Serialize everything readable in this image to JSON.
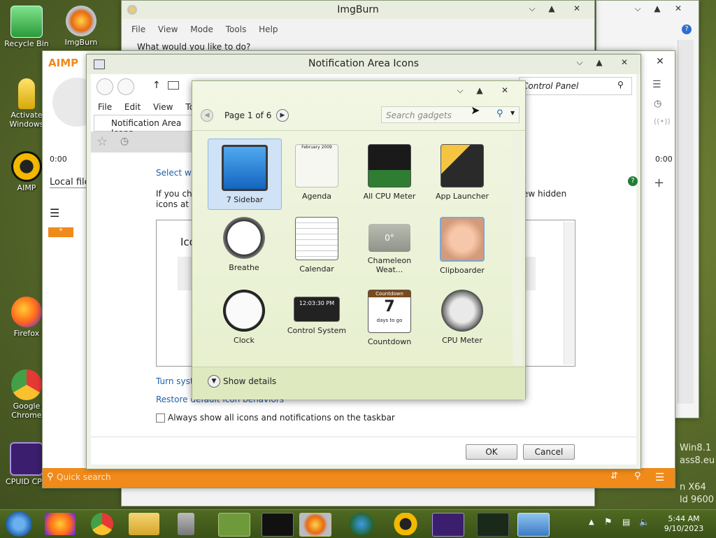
{
  "desktop": {
    "icons": [
      {
        "label": "Recycle Bin"
      },
      {
        "label": "ImgBurn"
      },
      {
        "label": "Activate Windows"
      },
      {
        "label": "AIMP"
      },
      {
        "label": "Firefox"
      },
      {
        "label": "Google Chrome"
      },
      {
        "label": "CPUID CPU"
      }
    ],
    "watermark": {
      "line1": "Win8.1",
      "line2": "ass8.eu",
      "line3": "n X64",
      "line4": "ld 9600"
    }
  },
  "imgburn": {
    "title": "ImgBurn",
    "menu": [
      "File",
      "View",
      "Mode",
      "Tools",
      "Help"
    ],
    "prompt": "What would you like to do?"
  },
  "aimp": {
    "logo": "AIMP",
    "time_left": "0:00",
    "time_right": "0:00",
    "local_files": "Local files",
    "quick_search": "Quick search",
    "tab_star": "*"
  },
  "notif": {
    "title": "Notification Area Icons",
    "address": "Control Panel",
    "menu": [
      "File",
      "Edit",
      "View",
      "Tools"
    ],
    "tab": "Notification Area Icons",
    "select_text": "Select whi",
    "if_text": "If you cho",
    "icons_text": "icons at a",
    "hidden_text": "ew hidden",
    "icon_col": "Ico",
    "turn_link": "Turn syste",
    "restore_link": "Restore default icon behaviors",
    "always_show": "Always show all icons and notifications on the taskbar",
    "ok": "OK",
    "cancel": "Cancel"
  },
  "gadgets": {
    "page": "Page 1 of 6",
    "search_placeholder": "Search gadgets",
    "show_details": "Show details",
    "items": [
      {
        "label": "7 Sidebar"
      },
      {
        "label": "Agenda"
      },
      {
        "label": "All CPU Meter"
      },
      {
        "label": "App Launcher"
      },
      {
        "label": "Breathe"
      },
      {
        "label": "Calendar"
      },
      {
        "label": "Chameleon Weat..."
      },
      {
        "label": "Clipboarder"
      },
      {
        "label": "Clock"
      },
      {
        "label": "Control System"
      },
      {
        "label": "Countdown"
      },
      {
        "label": "CPU Meter"
      }
    ],
    "agenda_month": "February 2009",
    "countdown_title": "Countdown",
    "countdown_num": "7",
    "countdown_sub": "days to go",
    "control_time": "12:03:30 PM",
    "weather_temp": "0°"
  },
  "taskbar": {
    "time": "5:44 AM",
    "date": "9/10/2023"
  }
}
